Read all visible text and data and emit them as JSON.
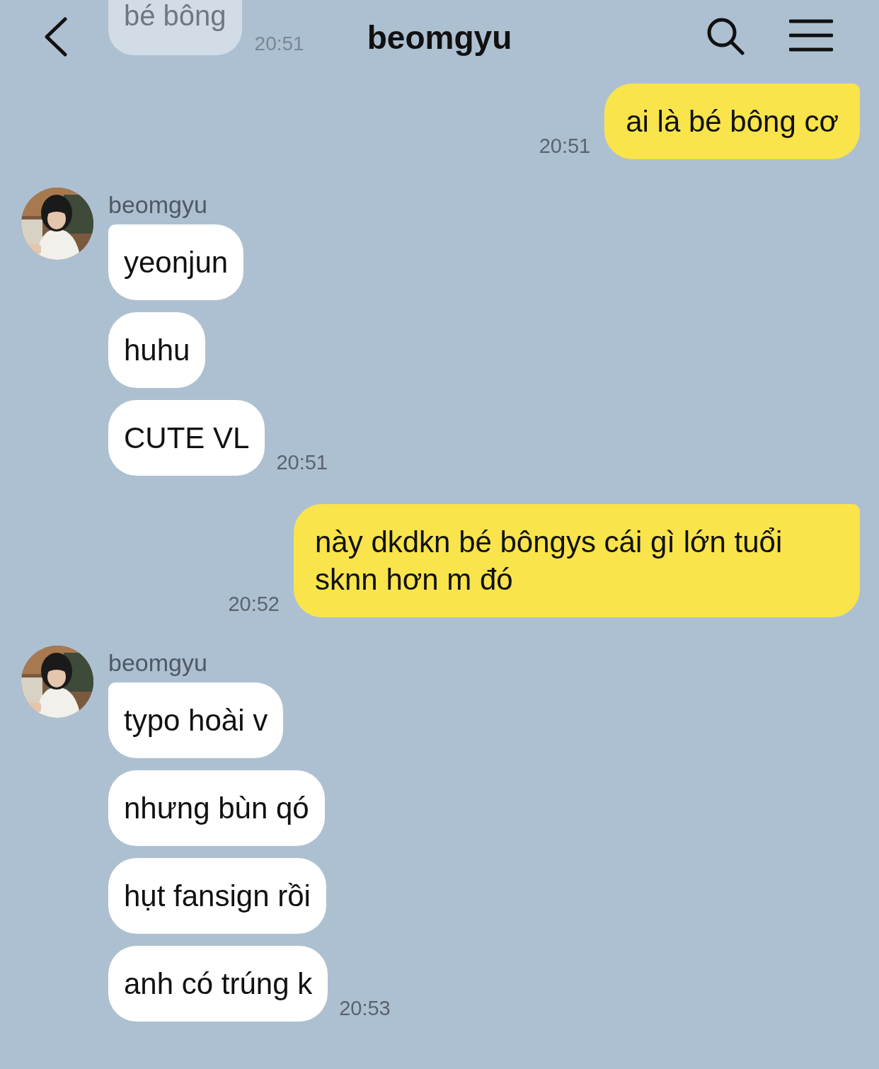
{
  "header": {
    "title": "beomgyu"
  },
  "behind_header": {
    "text": "bé bông",
    "time": "20:51"
  },
  "groups": [
    {
      "kind": "sent",
      "time": "20:51",
      "bubbles": [
        "ai là bé bông cơ"
      ]
    },
    {
      "kind": "received",
      "sender": "beomgyu",
      "time": "20:51",
      "bubbles": [
        "yeonjun",
        "huhu",
        "CUTE VL"
      ]
    },
    {
      "kind": "sent",
      "time": "20:52",
      "bubbles": [
        "này dkdkn bé bôngys cái gì lớn tuổi sknn hơn m đó"
      ]
    },
    {
      "kind": "received",
      "sender": "beomgyu",
      "time": "20:53",
      "bubbles": [
        "typo hoài v",
        "nhưng bùn qó",
        "hụt fansign rồi",
        "anh có trúng k"
      ]
    }
  ]
}
